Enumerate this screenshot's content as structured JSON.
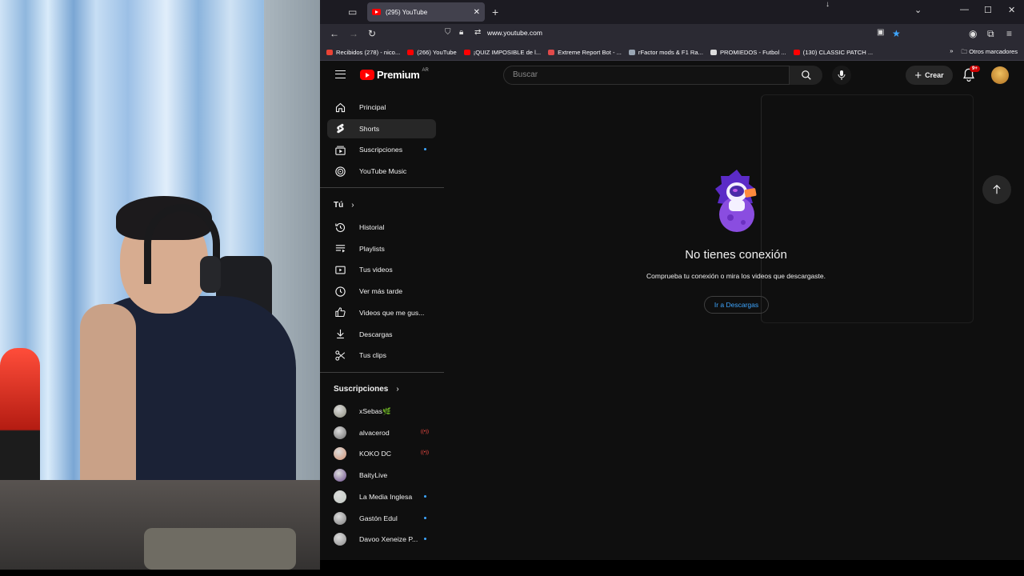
{
  "browser": {
    "tab_title": "(295) YouTube",
    "url": "www.youtube.com",
    "bookmarks": [
      {
        "label": "Recibidos (278) - nico...",
        "color": "#ea4335"
      },
      {
        "label": "(266) YouTube",
        "color": "#ff0000"
      },
      {
        "label": "¡QUIZ IMPOSIBLE de l...",
        "color": "#ff0000"
      },
      {
        "label": "Extreme Report Bot - ...",
        "color": "#e04a4a"
      },
      {
        "label": "rFactor mods & F1 Ra...",
        "color": "#9aa6b4"
      },
      {
        "label": "PROMIEDOS - Futbol ...",
        "color": "#dddddd"
      },
      {
        "label": "(130) CLASSIC PATCH ...",
        "color": "#ff0000"
      }
    ],
    "other_bookmarks": "Otros marcadores"
  },
  "youtube": {
    "logo_text": "Premium",
    "country": "AR",
    "search_placeholder": "Buscar",
    "create_label": "Crear",
    "notif_count": "9+",
    "nav": [
      {
        "label": "Principal",
        "icon": "home-icon"
      },
      {
        "label": "Shorts",
        "icon": "shorts-icon"
      },
      {
        "label": "Suscripciones",
        "icon": "subscriptions-icon"
      },
      {
        "label": "YouTube Music",
        "icon": "music-icon"
      }
    ],
    "you_section": "Tú",
    "you_items": [
      {
        "label": "Historial",
        "icon": "history-icon"
      },
      {
        "label": "Playlists",
        "icon": "playlists-icon"
      },
      {
        "label": "Tus videos",
        "icon": "your-videos-icon"
      },
      {
        "label": "Ver más tarde",
        "icon": "watch-later-icon"
      },
      {
        "label": "Videos que me gus...",
        "icon": "liked-icon"
      },
      {
        "label": "Descargas",
        "icon": "download-icon"
      },
      {
        "label": "Tus clips",
        "icon": "clips-icon"
      }
    ],
    "subs_section": "Suscripciones",
    "subscriptions": [
      {
        "name": "xSebas🌿",
        "status": "",
        "color": "#8a8a7a"
      },
      {
        "name": "alvacerod",
        "status": "live",
        "color": "#6a6a6a"
      },
      {
        "name": "KOKO DC",
        "status": "live",
        "color": "#d09070"
      },
      {
        "name": "BaityLive",
        "status": "",
        "color": "#6a4a8a"
      },
      {
        "name": "La Media Inglesa",
        "status": "new",
        "color": "#c0c8c0"
      },
      {
        "name": "Gastón Edul",
        "status": "new",
        "color": "#7a7a7a"
      },
      {
        "name": "Davoo Xeneize P...",
        "status": "new",
        "color": "#8a8a8a"
      }
    ],
    "offline": {
      "title": "No tienes conexión",
      "subtitle": "Comprueba tu conexión o mira los videos que descargaste.",
      "button": "Ir a Descargas"
    }
  }
}
